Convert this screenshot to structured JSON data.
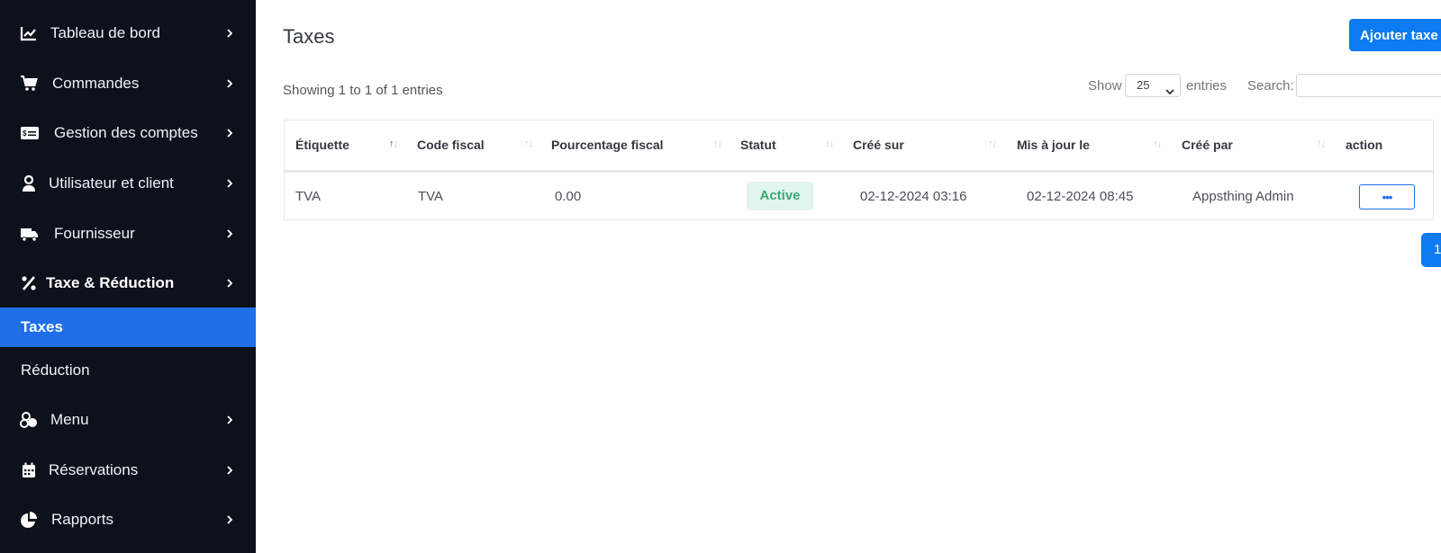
{
  "sidebar": {
    "items": [
      {
        "label": "Tableau de bord",
        "icon": "chart-line-icon"
      },
      {
        "label": "Commandes",
        "icon": "cart-icon"
      },
      {
        "label": "Gestion des comptes",
        "icon": "money-card-icon"
      },
      {
        "label": "Utilisateur et client",
        "icon": "user-icon"
      },
      {
        "label": "Fournisseur",
        "icon": "truck-icon"
      },
      {
        "label": "Taxe & Réduction",
        "icon": "percent-icon"
      },
      {
        "label": "Menu",
        "icon": "cookie-icon"
      },
      {
        "label": "Réservations",
        "icon": "calendar-icon"
      },
      {
        "label": "Rapports",
        "icon": "pie-chart-icon"
      }
    ],
    "subitems": [
      {
        "label": "Taxes",
        "active": true
      },
      {
        "label": "Réduction",
        "active": false
      }
    ]
  },
  "header": {
    "title": "Taxes",
    "add_button": "Ajouter taxe"
  },
  "table_controls": {
    "showing": "Showing 1 to 1 of 1 entries",
    "show_label": "Show",
    "page_size": "25",
    "entries_label": "entries",
    "search_label": "Search:"
  },
  "table": {
    "columns": [
      "Étiquette",
      "Code fiscal",
      "Pourcentage fiscal",
      "Statut",
      "Créé sur",
      "Mis à jour le",
      "Créé par",
      "action"
    ],
    "rows": [
      {
        "label": "TVA",
        "code": "TVA",
        "percent": "0.00",
        "status": "Active",
        "created": "02-12-2024 03:16",
        "updated": "02-12-2024 08:45",
        "created_by": "Appsthing Admin",
        "action": "•••"
      }
    ]
  },
  "pagination": {
    "current": "1"
  },
  "colors": {
    "sidebar_bg": "#0d111b",
    "active_item": "#1e6fe8",
    "primary": "#0d7bf2",
    "status_active_bg": "#e2f5ef",
    "status_active_text": "#3aa877"
  }
}
